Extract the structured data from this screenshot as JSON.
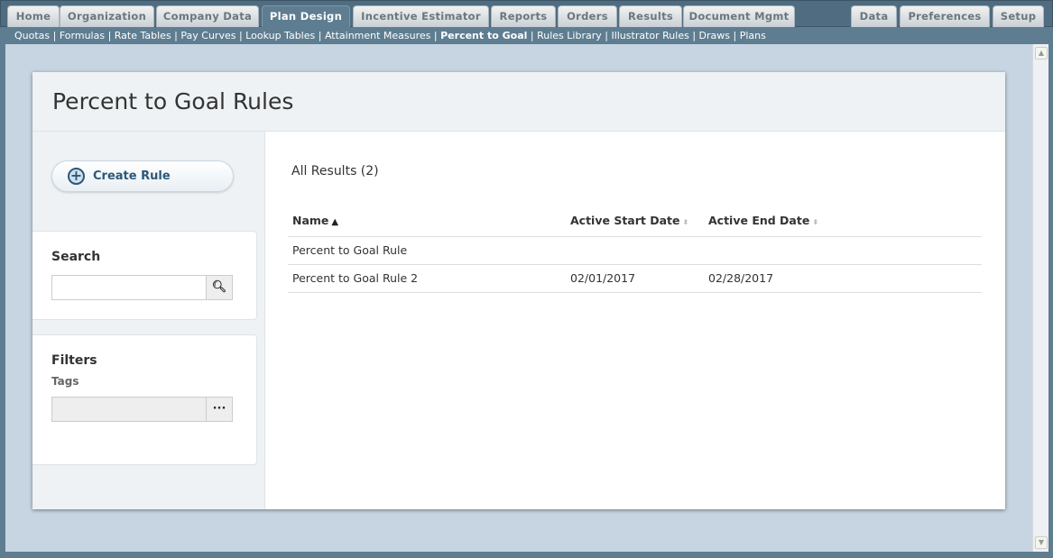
{
  "top_tabs": [
    {
      "label": "Home",
      "active": false
    },
    {
      "label": "Organization",
      "active": false
    },
    {
      "label": "Company Data",
      "active": false
    },
    {
      "label": "Plan Design",
      "active": true
    },
    {
      "label": "Incentive Estimator",
      "active": false
    },
    {
      "label": "Reports",
      "active": false
    },
    {
      "label": "Orders",
      "active": false
    },
    {
      "label": "Results",
      "active": false
    },
    {
      "label": "Document Mgmt",
      "active": false
    },
    {
      "label": "Data",
      "active": false
    },
    {
      "label": "Preferences",
      "active": false
    },
    {
      "label": "Setup",
      "active": false
    }
  ],
  "sub_nav": [
    "Quotas",
    "Formulas",
    "Rate Tables",
    "Pay Curves",
    "Lookup Tables",
    "Attainment Measures",
    "Percent to Goal",
    "Rules Library",
    "Illustrator Rules",
    "Draws",
    "Plans"
  ],
  "sub_nav_active": "Percent to Goal",
  "page_title": "Percent to Goal Rules",
  "sidebar": {
    "create_label": "Create Rule",
    "search_heading": "Search",
    "search_value": "",
    "filters_heading": "Filters",
    "tags_label": "Tags",
    "tags_button": "···"
  },
  "results": {
    "count_label": "All Results (2)",
    "columns": [
      "Name",
      "Active Start Date",
      "Active End Date"
    ],
    "rows": [
      [
        "Percent to Goal Rule",
        "",
        ""
      ],
      [
        "Percent to Goal Rule 2",
        "02/01/2017",
        "02/28/2017"
      ]
    ]
  }
}
